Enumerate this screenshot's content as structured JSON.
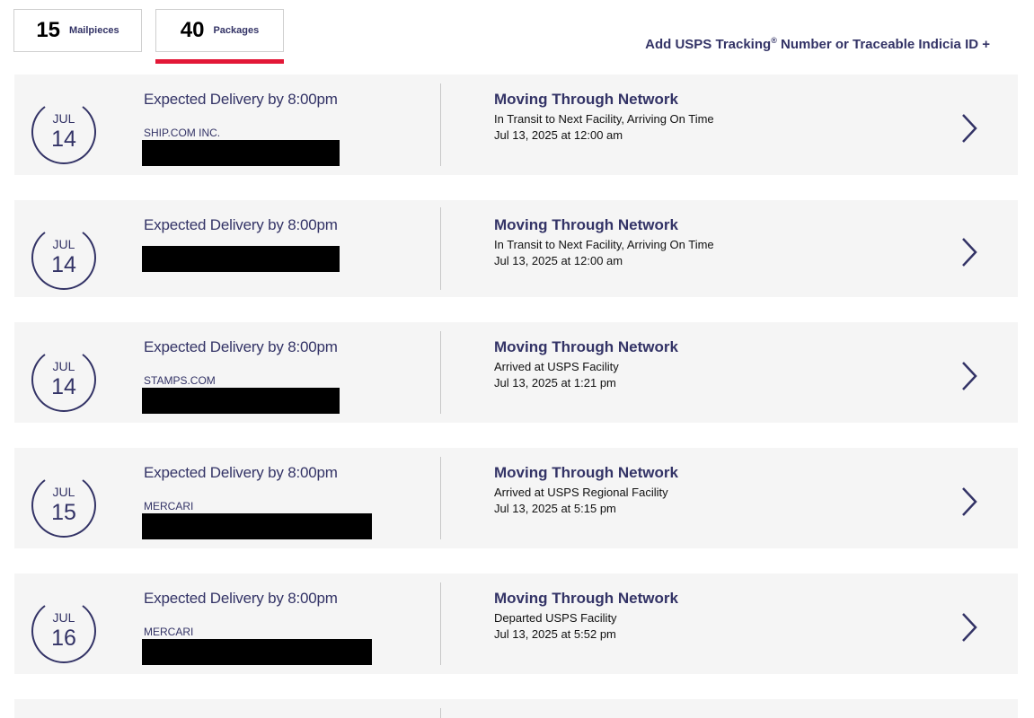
{
  "tabs": {
    "mailpieces": {
      "count": "15",
      "label": "Mailpieces"
    },
    "packages": {
      "count": "40",
      "label": "Packages"
    }
  },
  "add_tracking": {
    "prefix": "Add USPS Tracking",
    "reg": "®",
    "suffix": " Number or Traceable Indicia ID +"
  },
  "accent_color": "#e31837",
  "brand_color": "#333366",
  "packages": [
    {
      "month": "JUL",
      "day": "14",
      "expected": "Expected Delivery by 8:00pm",
      "shipper": "SHIP.COM INC.",
      "status": "Moving Through Network",
      "detail": "In Transit to Next Facility, Arriving On Time",
      "when": "Jul 13, 2025 at 12:00 am",
      "chevron_icon": "chevron-right-icon"
    },
    {
      "month": "JUL",
      "day": "14",
      "expected": "Expected Delivery by 8:00pm",
      "shipper": "",
      "status": "Moving Through Network",
      "detail": "In Transit to Next Facility, Arriving On Time",
      "when": "Jul 13, 2025 at 12:00 am",
      "chevron_icon": "chevron-right-icon"
    },
    {
      "month": "JUL",
      "day": "14",
      "expected": "Expected Delivery by 8:00pm",
      "shipper": "STAMPS.COM",
      "status": "Moving Through Network",
      "detail": "Arrived at USPS Facility",
      "when": "Jul 13, 2025 at 1:21 pm",
      "chevron_icon": "chevron-right-icon"
    },
    {
      "month": "JUL",
      "day": "15",
      "expected": "Expected Delivery by 8:00pm",
      "shipper": "MERCARI",
      "status": "Moving Through Network",
      "detail": "Arrived at USPS Regional Facility",
      "when": "Jul 13, 2025 at 5:15 pm",
      "chevron_icon": "chevron-right-icon"
    },
    {
      "month": "JUL",
      "day": "16",
      "expected": "Expected Delivery by 8:00pm",
      "shipper": "MERCARI",
      "status": "Moving Through Network",
      "detail": "Departed USPS Facility",
      "when": "Jul 13, 2025 at 5:52 pm",
      "chevron_icon": "chevron-right-icon"
    }
  ]
}
